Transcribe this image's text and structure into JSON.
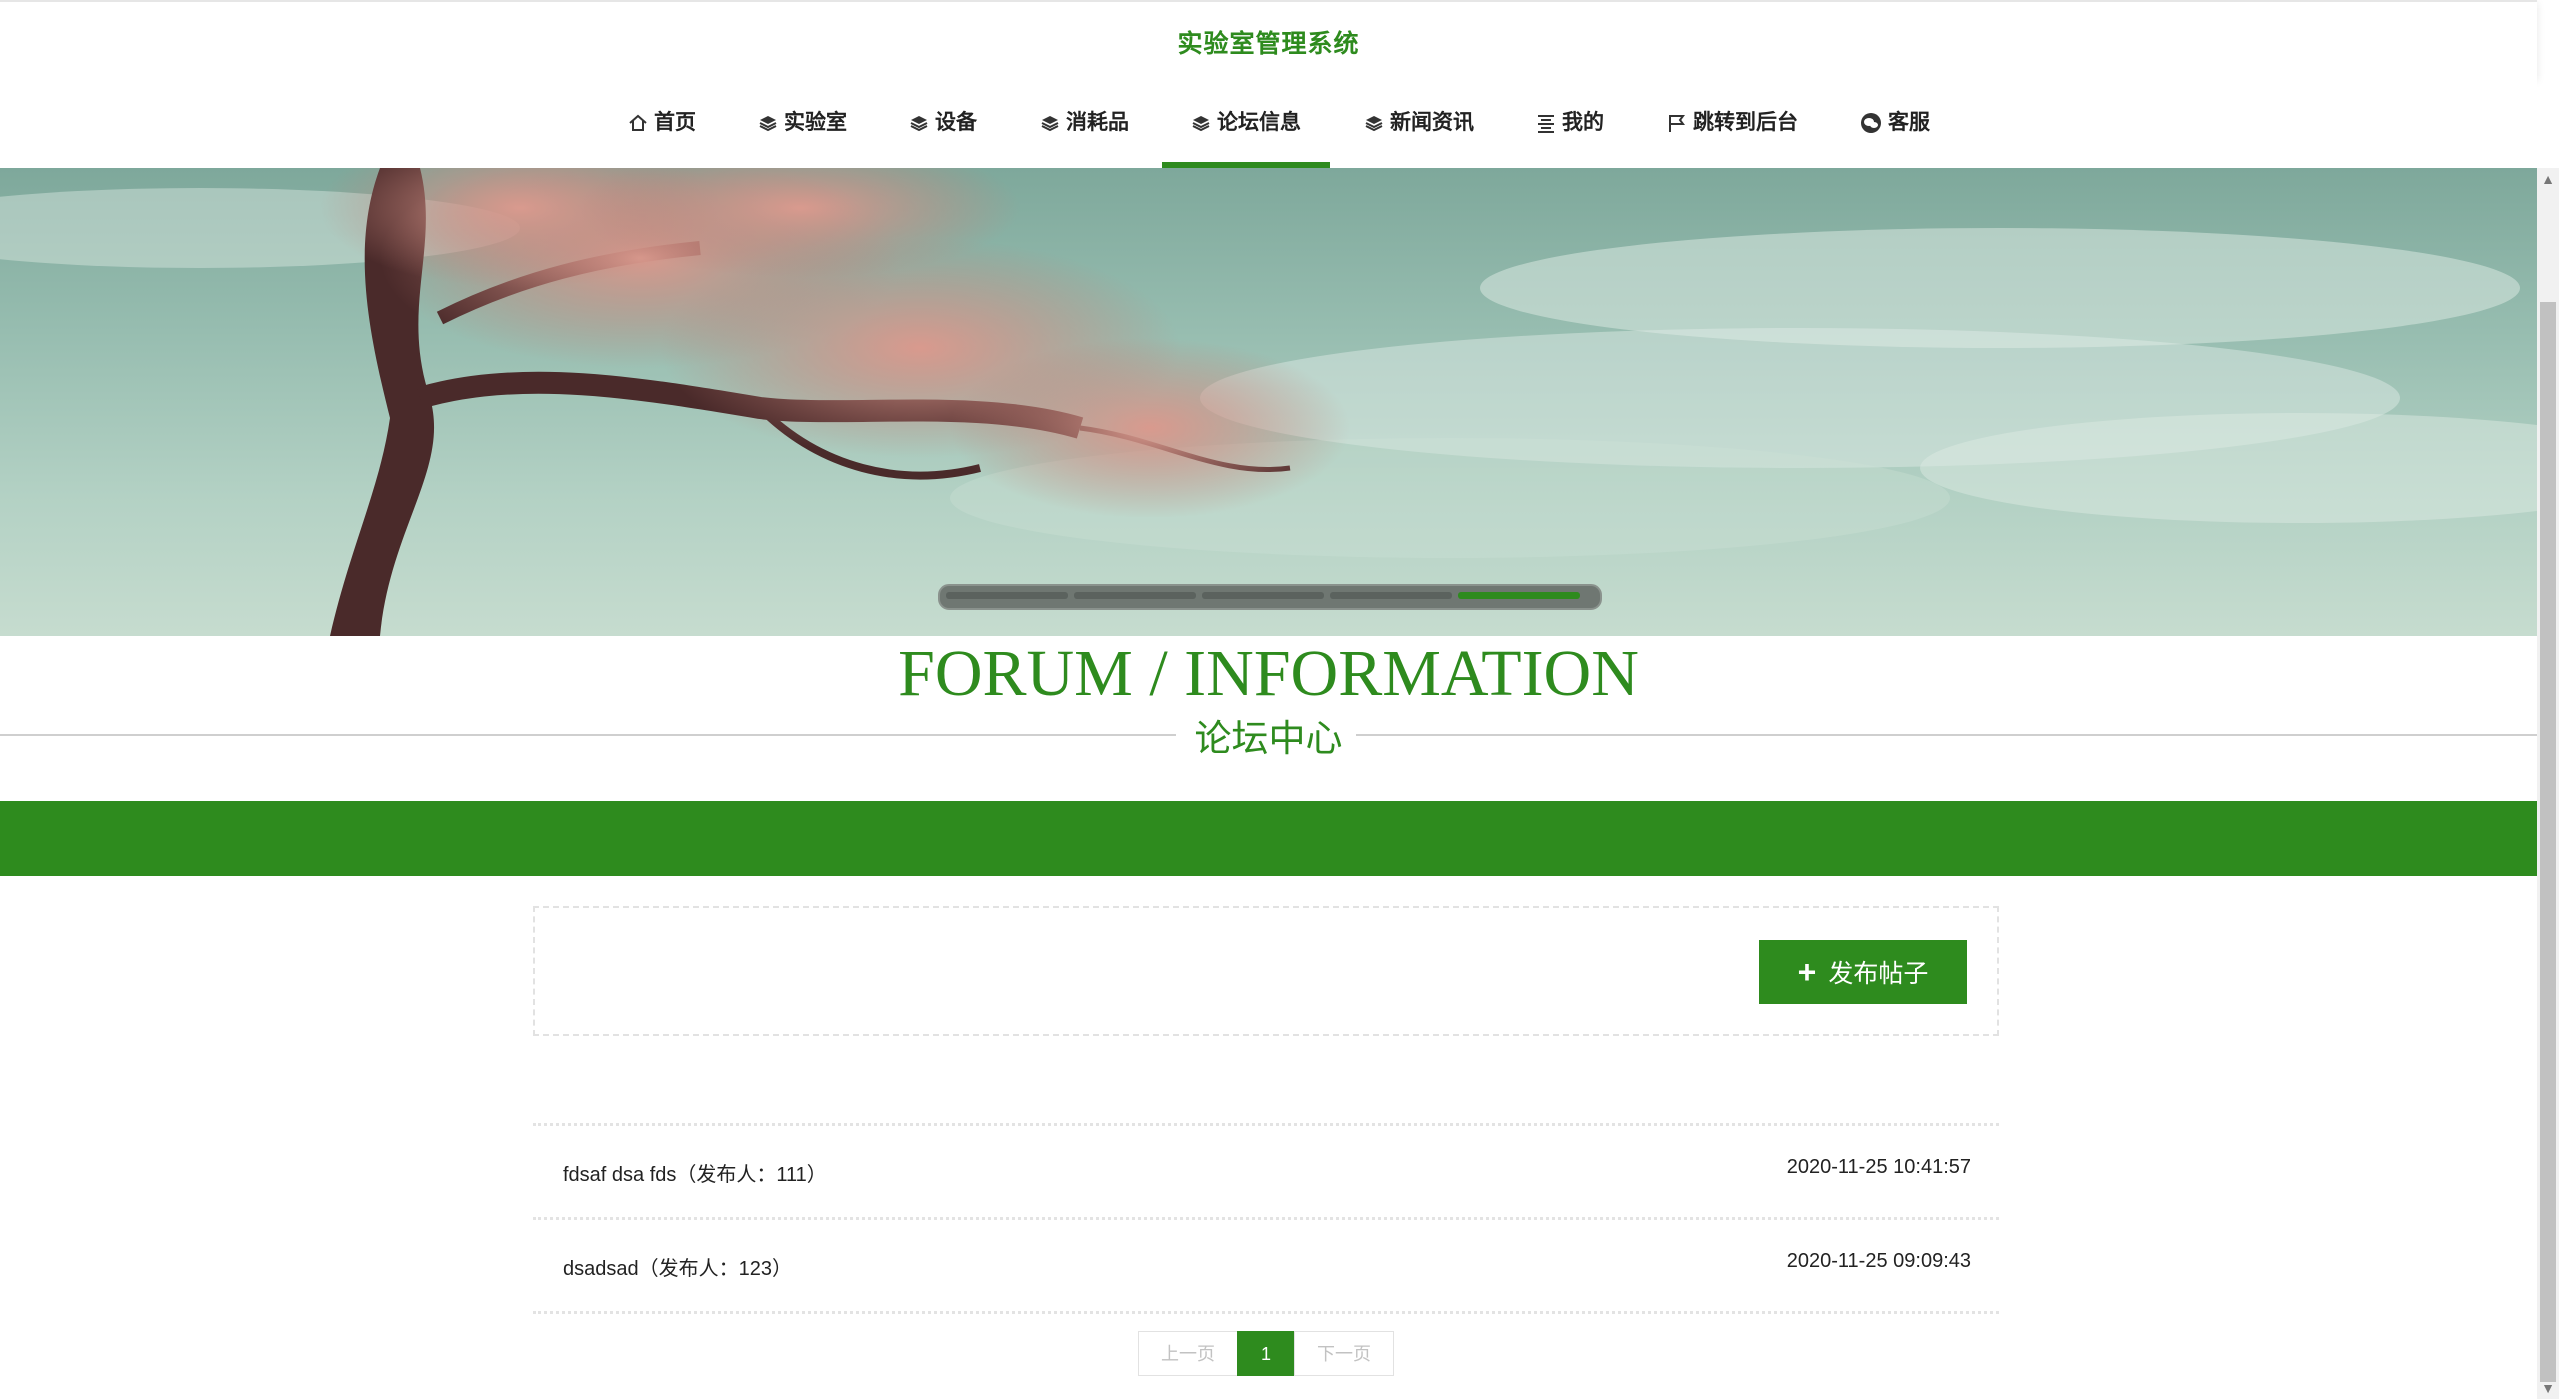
{
  "header": {
    "site_title": "实验室管理系统"
  },
  "nav": {
    "items": [
      {
        "label": "首页",
        "icon": "home-icon"
      },
      {
        "label": "实验室",
        "icon": "layers-icon"
      },
      {
        "label": "设备",
        "icon": "layers-icon"
      },
      {
        "label": "消耗品",
        "icon": "layers-icon"
      },
      {
        "label": "论坛信息",
        "icon": "layers-icon",
        "active": true
      },
      {
        "label": "新闻资讯",
        "icon": "layers-icon"
      },
      {
        "label": "我的",
        "icon": "list-icon"
      },
      {
        "label": "跳转到后台",
        "icon": "flag-icon"
      },
      {
        "label": "客服",
        "icon": "wechat-icon"
      }
    ]
  },
  "banner": {
    "slides": 5,
    "active_slide": 5
  },
  "section": {
    "title_en": "FORUM / INFORMATION",
    "title_cn": "论坛中心"
  },
  "toolbar": {
    "publish_label": "发布帖子"
  },
  "posts": [
    {
      "title": "fdsaf dsa fds（发布人：111）",
      "time": "2020-11-25 10:41:57"
    },
    {
      "title": "dsadsad（发布人：123）",
      "time": "2020-11-25 09:09:43"
    }
  ],
  "pagination": {
    "prev_label": "上一页",
    "current": "1",
    "next_label": "下一页"
  },
  "colors": {
    "accent": "#2e8b1e"
  }
}
